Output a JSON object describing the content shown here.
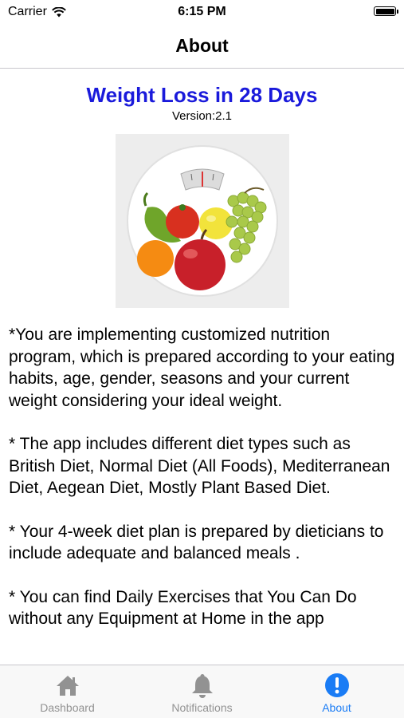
{
  "status_bar": {
    "carrier": "Carrier",
    "time": "6:15 PM"
  },
  "nav": {
    "title": "About"
  },
  "about": {
    "app_title": "Weight Loss in 28 Days",
    "version": "Version:2.1",
    "image_icon": "fruit-bowl-scale-image",
    "paragraphs": [
      "*You are implementing customized nutrition program, which is prepared according to your eating habits, age, gender, seasons and your current weight considering your ideal weight.",
      "* The app includes different diet types such as British Diet, Normal Diet (All Foods), Mediterranean Diet, Aegean Diet, Mostly Plant Based Diet.",
      "* Your 4-week diet plan is prepared by dieticians to include adequate and balanced meals .",
      "* You can find Daily Exercises that You Can Do without any Equipment at Home in the app"
    ]
  },
  "tabs": [
    {
      "label": "Dashboard",
      "icon": "home-icon",
      "active": false
    },
    {
      "label": "Notifications",
      "icon": "bell-icon",
      "active": false
    },
    {
      "label": "About",
      "icon": "info-icon",
      "active": true
    }
  ],
  "colors": {
    "title_blue": "#1a1adb",
    "tab_active": "#1a7cf5",
    "tab_inactive": "#929292"
  }
}
